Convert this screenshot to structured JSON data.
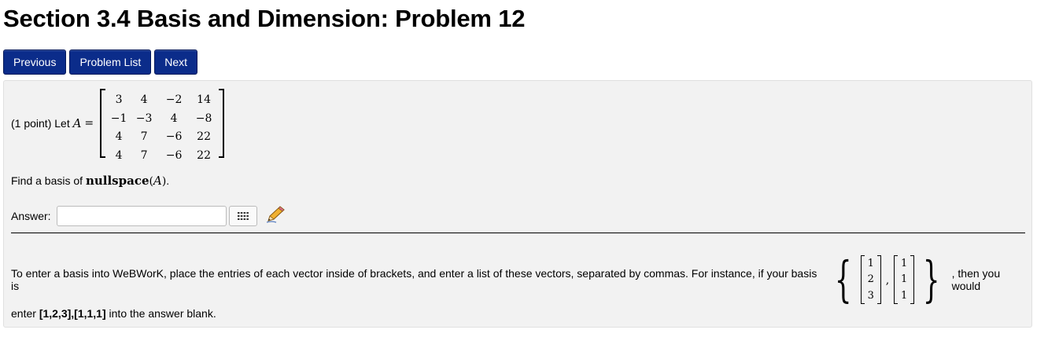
{
  "title": "Section 3.4 Basis and Dimension: Problem 12",
  "nav": {
    "previous": "Previous",
    "list": "Problem List",
    "next": "Next"
  },
  "problem": {
    "points_label": "(1 point) Let",
    "matrix_var": "A",
    "equals": "=",
    "matrix": [
      [
        "3",
        "4",
        "−2",
        "14"
      ],
      [
        "−1",
        "−3",
        "4",
        "−8"
      ],
      [
        "4",
        "7",
        "−6",
        "22"
      ],
      [
        "4",
        "7",
        "−6",
        "22"
      ]
    ],
    "find_prefix": "Find a basis of",
    "find_math": "nullspace",
    "find_arg": "(A)",
    "find_suffix": ".",
    "answer_label": "Answer:",
    "answer_value": "",
    "matrix_button_icon": "grid-icon",
    "pencil_icon": "pencil-icon"
  },
  "help": {
    "line1_prefix": "To enter a basis into WeBWorK, place the entries of each vector inside of brackets, and enter a list of these vectors, separated by commas. For instance, if your basis is",
    "vector1": [
      "1",
      "2",
      "3"
    ],
    "vector2": [
      "1",
      "1",
      "1"
    ],
    "line1_suffix": ", then you would",
    "line2_prefix": "enter",
    "example": "[1,2,3],[1,1,1]",
    "line2_suffix": "into the answer blank."
  }
}
